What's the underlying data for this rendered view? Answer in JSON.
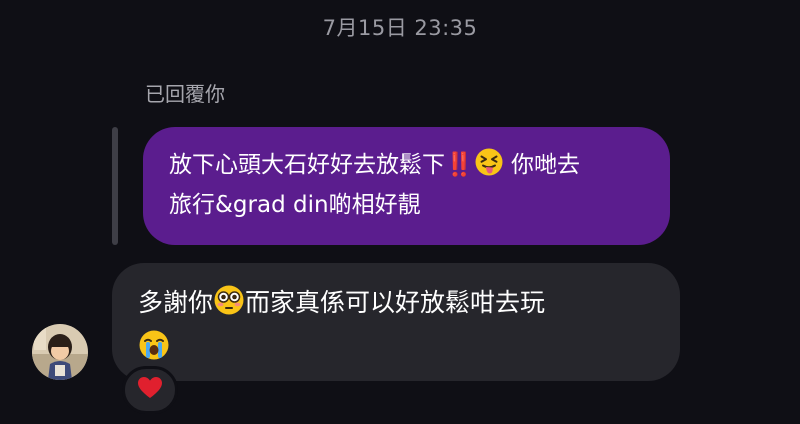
{
  "timestamp": "7月15日 23:35",
  "reply_label": "已回覆你",
  "quoted_message": {
    "text_1": "放下心頭大石好好去放鬆下‼️",
    "emoji_1": "squinting-face-with-tongue",
    "text_2": " 你哋去\n旅行&grad din啲相好靚"
  },
  "message": {
    "text_1": "多謝你",
    "emoji_1": "flushed-face",
    "text_2": "而家真係可以好放鬆咁去玩",
    "emoji_2": "loudly-crying-face"
  },
  "reaction": {
    "emoji": "red-heart"
  },
  "colors": {
    "background": "#0f0f15",
    "quoted_bubble": "#5b1d8e",
    "message_bubble": "#26262c",
    "timestamp": "#9a9aa2",
    "heart": "#e0202e"
  }
}
